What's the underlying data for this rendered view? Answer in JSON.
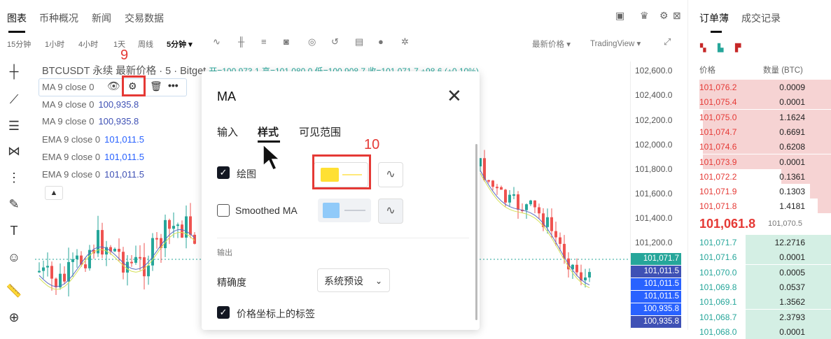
{
  "top_tabs": [
    "图表",
    "币种概况",
    "新闻",
    "交易数据"
  ],
  "intervals": [
    "15分钟",
    "1小时",
    "4小时",
    "1天",
    "周线",
    "5分钟 ▾"
  ],
  "toolbar_right": {
    "price_mode": "最新价格 ▾",
    "source": "TradingView ▾"
  },
  "symbol_header": {
    "title": "BTCUSDT 永续 最新价格 · 5 · Bitget",
    "ohlc": "开=100,973.1 高=101,080.0 低=100,908.7 收=101,071.7 +98.6 (+0.10%)"
  },
  "indicators": [
    {
      "label": "MA 9 close 0",
      "value": ""
    },
    {
      "label": "MA 9 close 0",
      "value": "100,935.8"
    },
    {
      "label": "MA 9 close 0",
      "value": "100,935.8"
    },
    {
      "label": "EMA 9 close 0",
      "value": "101,011.5"
    },
    {
      "label": "EMA 9 close 0",
      "value": "101,011.5"
    },
    {
      "label": "EMA 9 close 0",
      "value": "101,011.5"
    }
  ],
  "price_axis": [
    "102,600.0",
    "102,400.0",
    "102,200.0",
    "102,000.0",
    "101,800.0",
    "101,600.0",
    "101,400.0",
    "101,200.0"
  ],
  "price_tags": [
    {
      "text": "101,071.7",
      "color": "#26a69a"
    },
    {
      "text": "101,011.5",
      "color": "#3f51b5"
    },
    {
      "text": "101,011.5",
      "color": "#2962ff"
    },
    {
      "text": "101,011.5",
      "color": "#2962ff"
    },
    {
      "text": "100,935.8",
      "color": "#2962ff"
    },
    {
      "text": "100,935.8",
      "color": "#3f51b5"
    }
  ],
  "modal": {
    "title": "MA",
    "close": "✕",
    "tabs": [
      "输入",
      "样式",
      "可见范围"
    ],
    "plot_label": "绘图",
    "plot_color": "#ffe033",
    "smoothed_label": "Smoothed MA",
    "smoothed_color": "#90caf9",
    "section_output": "输出",
    "precision_label": "精确度",
    "precision_value": "系统预设",
    "price_scale_label": "价格坐标上的标签"
  },
  "annotations": {
    "step9": "9",
    "step10": "10"
  },
  "orderbook": {
    "tabs": [
      "订单薄",
      "成交记录"
    ],
    "col_price": "价格",
    "col_qty": "数量 (BTC)",
    "asks": [
      {
        "price": "101,076.2",
        "qty": "0.0009",
        "depth": 0.92
      },
      {
        "price": "101,075.4",
        "qty": "0.0001",
        "depth": 0.92
      },
      {
        "price": "101,075.0",
        "qty": "1.1624",
        "depth": 0.9
      },
      {
        "price": "101,074.7",
        "qty": "0.6691",
        "depth": 0.9
      },
      {
        "price": "101,074.6",
        "qty": "0.6208",
        "depth": 0.9
      },
      {
        "price": "101,073.9",
        "qty": "0.0001",
        "depth": 0.9
      },
      {
        "price": "101,072.2",
        "qty": "0.1361",
        "depth": 0.35
      },
      {
        "price": "101,071.9",
        "qty": "0.1303",
        "depth": 0.15
      },
      {
        "price": "101,071.8",
        "qty": "1.4181",
        "depth": 0.1
      }
    ],
    "last_price": "101,061.8",
    "mark_price": "101,070.5",
    "bids": [
      {
        "price": "101,071.7",
        "qty": "12.2716",
        "depth": 0.6
      },
      {
        "price": "101,071.6",
        "qty": "0.0001",
        "depth": 0.6
      },
      {
        "price": "101,070.0",
        "qty": "0.0005",
        "depth": 0.6
      },
      {
        "price": "101,069.8",
        "qty": "0.0537",
        "depth": 0.6
      },
      {
        "price": "101,069.1",
        "qty": "1.3562",
        "depth": 0.6
      },
      {
        "price": "101,068.7",
        "qty": "2.3793",
        "depth": 0.6
      },
      {
        "price": "101,068.0",
        "qty": "0.0001",
        "depth": 0.6
      }
    ],
    "ask_color": "#f6d3d3",
    "bid_color": "#d4efe4"
  },
  "left_tools": [
    "crosshair-icon",
    "trendline-icon",
    "fib-icon",
    "pattern-icon",
    "projection-icon",
    "brush-icon",
    "text-icon",
    "emoji-icon",
    "ruler-icon",
    "zoom-icon"
  ]
}
